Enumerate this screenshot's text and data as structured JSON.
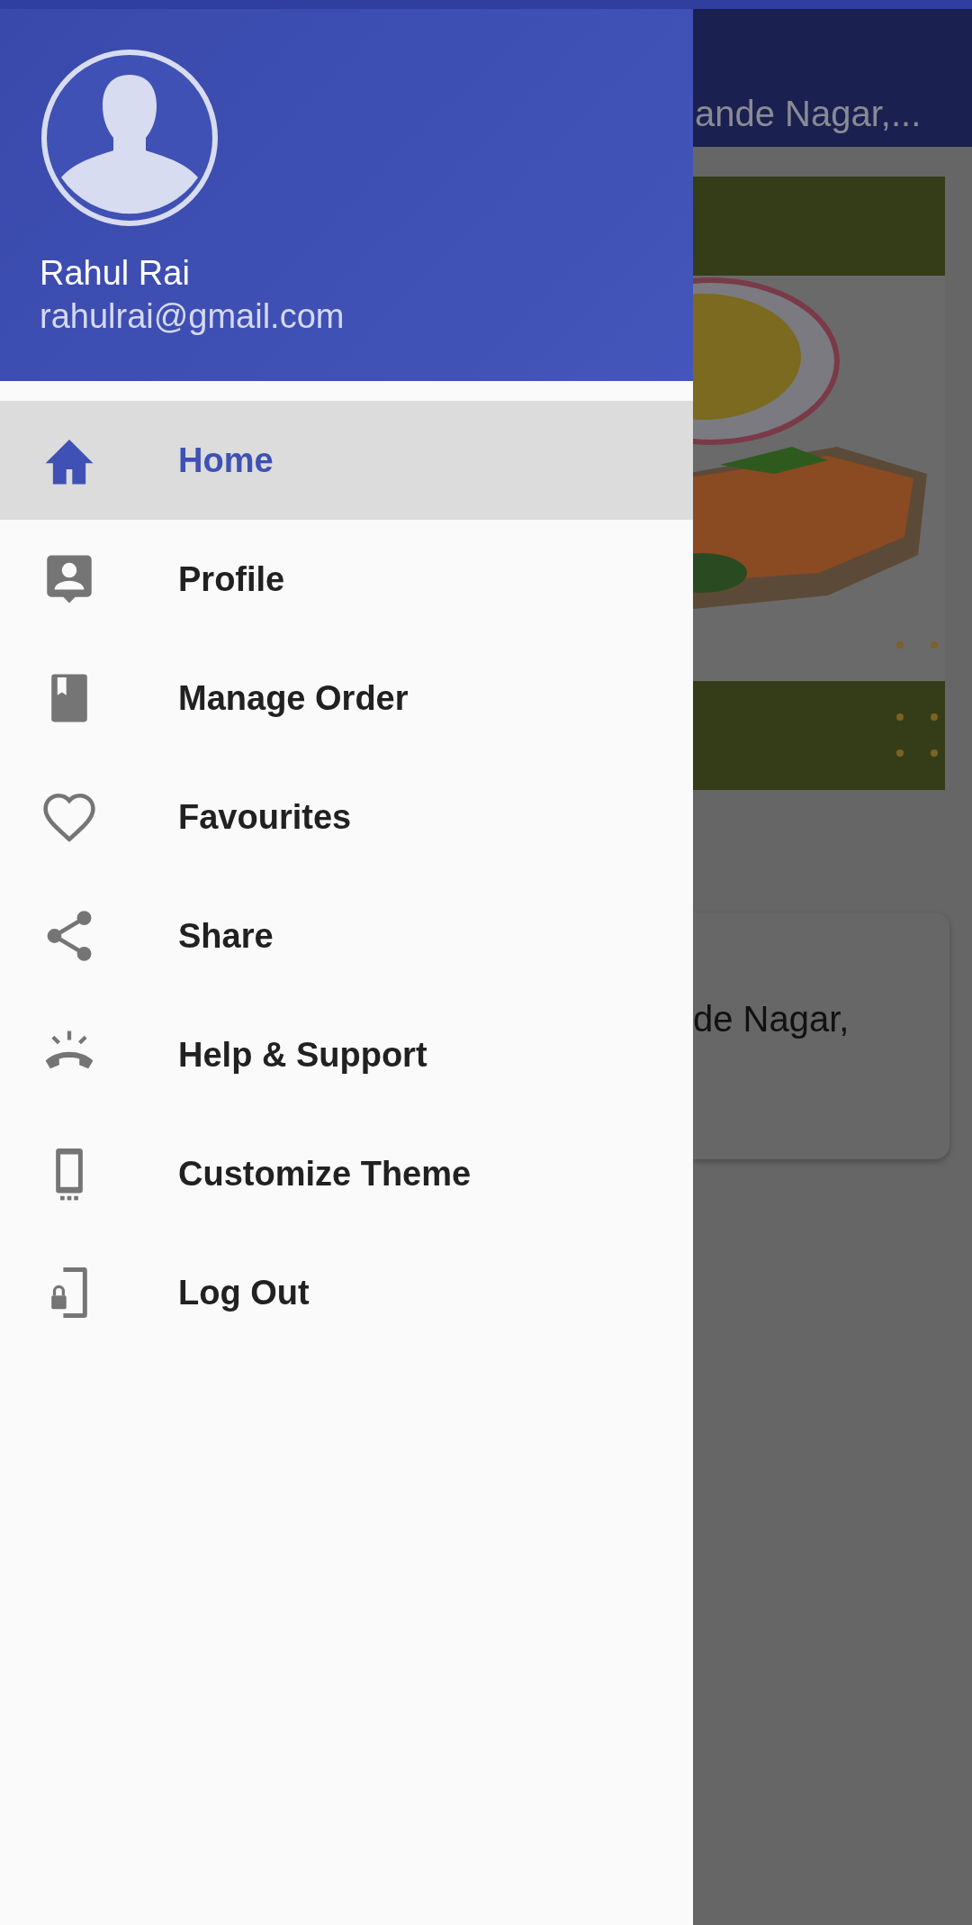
{
  "drawer": {
    "user_name": "Rahul Rai",
    "user_email": "rahulrai@gmail.com",
    "menu": [
      {
        "label": "Home",
        "selected": true
      },
      {
        "label": "Profile",
        "selected": false
      },
      {
        "label": "Manage Order",
        "selected": false
      },
      {
        "label": "Favourites",
        "selected": false
      },
      {
        "label": "Share",
        "selected": false
      },
      {
        "label": "Help & Support",
        "selected": false
      },
      {
        "label": "Customize Theme",
        "selected": false
      },
      {
        "label": "Log Out",
        "selected": false
      }
    ]
  },
  "background": {
    "app_bar_title": "ande Nagar,...",
    "address_text": "de Nagar,"
  }
}
